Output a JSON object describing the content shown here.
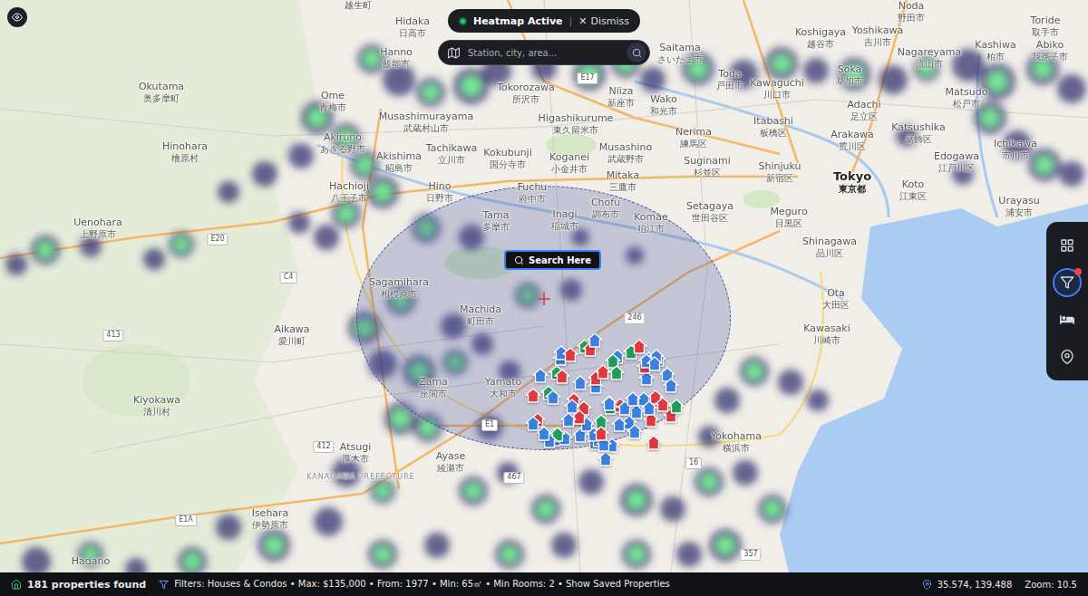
{
  "heatmap": {
    "label": "Heatmap Active",
    "active": true,
    "separator": "|",
    "dismiss_icon": "✕",
    "dismiss": "Dismiss"
  },
  "search": {
    "placeholder": "Station, city, area..."
  },
  "search_here": "Search Here",
  "places": [
    {
      "kind": "city",
      "local": "越生町"
    },
    {
      "kind": "city",
      "name": "Hidaka",
      "local": "日高市"
    },
    {
      "kind": "city",
      "name": "Hanno",
      "local": "飯能市"
    },
    {
      "kind": "city",
      "name": "Saitama",
      "local": "さいたま市"
    },
    {
      "kind": "city",
      "name": "Koshigaya",
      "local": "越谷市"
    },
    {
      "kind": "city",
      "name": "Yoshikawa",
      "local": "吉川市"
    },
    {
      "kind": "city",
      "name": "Noda",
      "local": "野田市"
    },
    {
      "kind": "city",
      "name": "Toride",
      "local": "取手市"
    },
    {
      "kind": "city",
      "name": "Nagareyama",
      "local": "流山市"
    },
    {
      "kind": "city",
      "name": "Kashiwa",
      "local": "柏市"
    },
    {
      "kind": "city",
      "name": "Abiko",
      "local": "我孫子市"
    },
    {
      "kind": "city",
      "name": "Okutama",
      "local": "奥多摩町"
    },
    {
      "kind": "city",
      "name": "Ome",
      "local": "青梅市"
    },
    {
      "kind": "city",
      "name": "Tokorozawa",
      "local": "所沢市"
    },
    {
      "kind": "city",
      "name": "Niiza",
      "local": "新座市"
    },
    {
      "kind": "city",
      "name": "Wako",
      "local": "和光市"
    },
    {
      "kind": "city",
      "name": "Toda",
      "local": "戸田市"
    },
    {
      "kind": "city",
      "name": "Kawaguchi",
      "local": "川口市"
    },
    {
      "kind": "city",
      "name": "Soka",
      "local": "草加市"
    },
    {
      "kind": "city",
      "name": "Adachi",
      "local": "足立区"
    },
    {
      "kind": "city",
      "name": "Matsudo",
      "local": "松戸市"
    },
    {
      "kind": "city",
      "name": "Musashimurayama",
      "local": "武蔵村山市"
    },
    {
      "kind": "city",
      "name": "Higashikurume",
      "local": "東久留米市"
    },
    {
      "kind": "city",
      "name": "Itabashi",
      "local": "板橋区"
    },
    {
      "kind": "city",
      "name": "Katsushika",
      "local": "葛飾区"
    },
    {
      "kind": "city",
      "name": "Hinohara",
      "local": "檜原村"
    },
    {
      "kind": "city",
      "name": "Akiruno",
      "local": "あきる野市"
    },
    {
      "kind": "city",
      "name": "Nerima",
      "local": "練馬区"
    },
    {
      "kind": "city",
      "name": "Arakawa",
      "local": "荒川区"
    },
    {
      "kind": "city",
      "name": "Ichikawa",
      "local": "市川市"
    },
    {
      "kind": "city",
      "name": "Tachikawa",
      "local": "立川市"
    },
    {
      "kind": "city",
      "name": "Kokubunji",
      "local": "国分寺市"
    },
    {
      "kind": "city",
      "name": "Koganei",
      "local": "小金井市"
    },
    {
      "kind": "city",
      "name": "Musashino",
      "local": "武蔵野市"
    },
    {
      "kind": "city",
      "name": "Akishima",
      "local": "昭島市"
    },
    {
      "kind": "city",
      "name": "Suginami",
      "local": "杉並区"
    },
    {
      "kind": "city",
      "name": "Edogawa",
      "local": "江戸川区"
    },
    {
      "kind": "city",
      "name": "Shinjuku",
      "local": "新宿区"
    },
    {
      "kind": "capital",
      "name": "Tokyo",
      "local": "東京都"
    },
    {
      "kind": "city",
      "name": "Mitaka",
      "local": "三鷹市"
    },
    {
      "kind": "city",
      "name": "Hino",
      "local": "日野市"
    },
    {
      "kind": "city",
      "name": "Hachioji",
      "local": "八王子市"
    },
    {
      "kind": "city",
      "name": "Fuchu",
      "local": "府中市"
    },
    {
      "kind": "city",
      "name": "Koto",
      "local": "江東区"
    },
    {
      "kind": "city",
      "name": "Urayasu",
      "local": "浦安市"
    },
    {
      "kind": "city",
      "name": "Tama",
      "local": "多摩市"
    },
    {
      "kind": "city",
      "name": "Inagi",
      "local": "稲城市"
    },
    {
      "kind": "city",
      "name": "Chofu",
      "local": "調布市"
    },
    {
      "kind": "city",
      "name": "Komae",
      "local": "狛江市"
    },
    {
      "kind": "city",
      "name": "Setagaya",
      "local": "世田谷区"
    },
    {
      "kind": "city",
      "name": "Meguro",
      "local": "目黒区"
    },
    {
      "kind": "city",
      "name": "Uenohara",
      "local": "上野原市"
    },
    {
      "kind": "city",
      "name": "Shinagawa",
      "local": "品川区"
    },
    {
      "kind": "city",
      "name": "Sagamihara",
      "local": "相模原市"
    },
    {
      "kind": "city",
      "name": "Ota",
      "local": "大田区"
    },
    {
      "kind": "city",
      "name": "Machida",
      "local": "町田市"
    },
    {
      "kind": "city",
      "name": "Aikawa",
      "local": "愛川町"
    },
    {
      "kind": "city",
      "name": "Kawasaki",
      "local": "川崎市"
    },
    {
      "kind": "city",
      "name": "Zama",
      "local": "座間市"
    },
    {
      "kind": "city",
      "name": "Yamato",
      "local": "大和市"
    },
    {
      "kind": "city",
      "name": "Kiyokawa",
      "local": "清川村"
    },
    {
      "kind": "city",
      "name": "Yokohama",
      "local": "横浜市"
    },
    {
      "kind": "city",
      "name": "Atsugi",
      "local": "厚木市"
    },
    {
      "kind": "city",
      "name": "Ayase",
      "local": "綾瀬市"
    },
    {
      "kind": "prefecture",
      "name": "KANAGAWA PREFECTURE"
    },
    {
      "kind": "city",
      "name": "Isehara",
      "local": "伊勢原市"
    },
    {
      "kind": "city",
      "name": "Hadano"
    }
  ],
  "roads": [
    "E20",
    "C4",
    "413",
    "412",
    "E1",
    "246",
    "16",
    "357",
    "E1A",
    "467",
    "E17"
  ],
  "pins": [
    {
      "color": "#3b7fe0"
    },
    {
      "color": "#e0383e"
    },
    {
      "color": "#3b7fe0"
    },
    {
      "color": "#1f9e5a"
    },
    {
      "color": "#3b7fe0"
    },
    {
      "color": "#e0383e"
    },
    {
      "color": "#3b7fe0"
    },
    {
      "color": "#3b7fe0"
    },
    {
      "color": "#e0383e"
    },
    {
      "color": "#3b7fe0"
    },
    {
      "color": "#1f9e5a"
    },
    {
      "color": "#3b7fe0"
    },
    {
      "color": "#e0383e"
    },
    {
      "color": "#3b7fe0"
    },
    {
      "color": "#3b7fe0"
    },
    {
      "color": "#e0383e"
    },
    {
      "color": "#3b7fe0"
    },
    {
      "color": "#1f9e5a"
    },
    {
      "color": "#3b7fe0"
    },
    {
      "color": "#e0383e"
    },
    {
      "color": "#3b7fe0"
    },
    {
      "color": "#3b7fe0"
    },
    {
      "color": "#3b7fe0"
    },
    {
      "color": "#e0383e"
    },
    {
      "color": "#1f9e5a"
    },
    {
      "color": "#3b7fe0"
    },
    {
      "color": "#e0383e"
    },
    {
      "color": "#3b7fe0"
    },
    {
      "color": "#3b7fe0"
    },
    {
      "color": "#e0383e"
    },
    {
      "color": "#3b7fe0"
    },
    {
      "color": "#1f9e5a"
    },
    {
      "color": "#3b7fe0"
    },
    {
      "color": "#e0383e"
    },
    {
      "color": "#3b7fe0"
    },
    {
      "color": "#3b7fe0"
    },
    {
      "color": "#e0383e"
    },
    {
      "color": "#3b7fe0"
    },
    {
      "color": "#3b7fe0"
    },
    {
      "color": "#1f9e5a"
    },
    {
      "color": "#e0383e"
    },
    {
      "color": "#3b7fe0"
    },
    {
      "color": "#3b7fe0"
    },
    {
      "color": "#e0383e"
    },
    {
      "color": "#3b7fe0"
    },
    {
      "color": "#3b7fe0"
    },
    {
      "color": "#1f9e5a"
    },
    {
      "color": "#3b7fe0"
    },
    {
      "color": "#e0383e"
    },
    {
      "color": "#3b7fe0"
    },
    {
      "color": "#3b7fe0"
    },
    {
      "color": "#e0383e"
    },
    {
      "color": "#3b7fe0"
    },
    {
      "color": "#1f9e5a"
    },
    {
      "color": "#3b7fe0"
    },
    {
      "color": "#3b7fe0"
    },
    {
      "color": "#e0383e"
    },
    {
      "color": "#3b7fe0"
    },
    {
      "color": "#3b7fe0"
    },
    {
      "color": "#3b7fe0"
    },
    {
      "color": "#e0383e"
    },
    {
      "color": "#1f9e5a"
    },
    {
      "color": "#3b7fe0"
    },
    {
      "color": "#3b7fe0"
    },
    {
      "color": "#e0383e"
    },
    {
      "color": "#3b7fe0"
    },
    {
      "color": "#3b7fe0"
    },
    {
      "color": "#e0383e"
    },
    {
      "color": "#3b7fe0"
    },
    {
      "color": "#1f9e5a"
    },
    {
      "color": "#3b7fe0"
    },
    {
      "color": "#3b7fe0"
    }
  ],
  "toolbar": [
    {
      "kind": "grid",
      "selected": false,
      "badge": false
    },
    {
      "kind": "filter",
      "selected": true,
      "badge": true
    },
    {
      "kind": "beds",
      "selected": false,
      "badge": false
    },
    {
      "kind": "location",
      "selected": false,
      "badge": false
    }
  ],
  "status_bar": {
    "count": "181 properties found",
    "filters": "Filters: Houses & Condos • Max: $135,000 • From: 1977 • Min: 65㎡ • Min Rooms: 2 • Show Saved Properties",
    "coords": "35.574, 139.488",
    "zoom": "Zoom: 10.5"
  }
}
